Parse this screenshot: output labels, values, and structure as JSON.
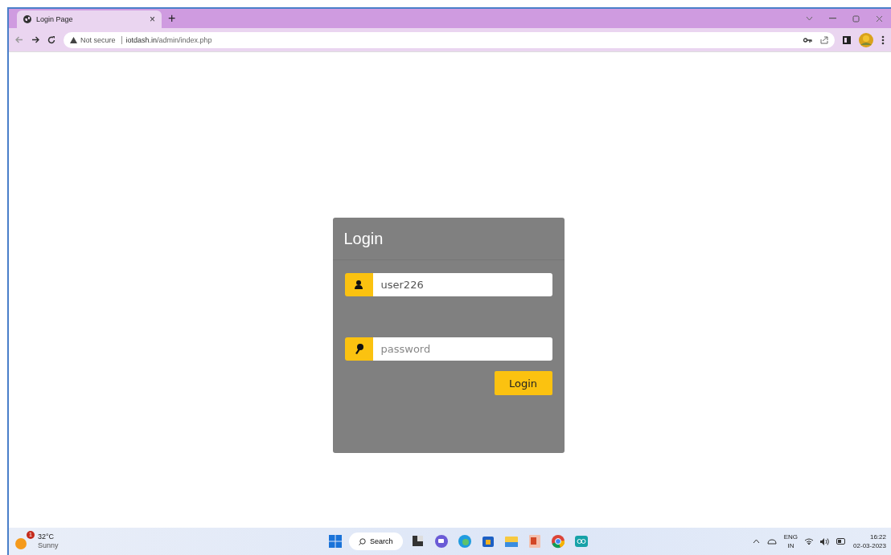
{
  "browser": {
    "tabs": [
      {
        "title": "Login Page",
        "close": "×",
        "selected": true
      }
    ],
    "new_tab": "+",
    "security": "Not secure",
    "url_host": "iotdash.in",
    "url_path": "/admin/index.php"
  },
  "login": {
    "title": "Login",
    "username": {
      "value": "user226"
    },
    "password": {
      "placeholder": "password"
    },
    "button": "Login"
  },
  "taskbar": {
    "weather": {
      "badge": "1",
      "temp": "32°C",
      "condition": "Sunny"
    },
    "search": "Search",
    "apps": [
      {
        "kind": "widgets"
      },
      {
        "kind": "chat"
      },
      {
        "kind": "edge"
      },
      {
        "kind": "store"
      },
      {
        "kind": "folder"
      },
      {
        "kind": "slides"
      },
      {
        "kind": "chrome"
      },
      {
        "kind": "arduino"
      }
    ],
    "tray": {
      "lang": "ENG",
      "region": "IN",
      "time": "16:22",
      "date": "02-03-2023"
    }
  }
}
